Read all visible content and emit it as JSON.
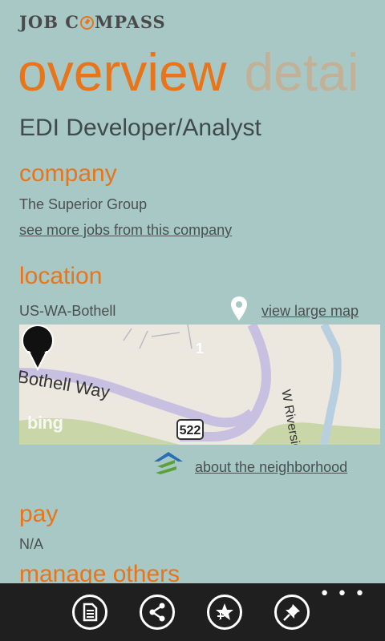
{
  "app": {
    "title_part1": "JOB C",
    "title_part2": "MPASS"
  },
  "pivot": {
    "active": "overview",
    "next": "detai"
  },
  "job": {
    "title": "EDI Developer/Analyst"
  },
  "company": {
    "heading": "company",
    "name": "The Superior Group",
    "more_jobs_link": "see more jobs from this company"
  },
  "location": {
    "heading": "location",
    "value": "US-WA-Bothell",
    "map_link": "view large map",
    "pin_icon": "map-pin-icon",
    "map": {
      "road_left": "Bothell Way",
      "road_right": "W Riverside D",
      "highway": "522",
      "pushpin_number": "1",
      "provider": "bing"
    },
    "neighborhood_link": "about the neighborhood",
    "neighborhood_icon": "zillow-icon"
  },
  "pay": {
    "heading": "pay",
    "value": "N/A"
  },
  "manage": {
    "heading": "manage others"
  },
  "appbar": {
    "ellipsis": "• • •",
    "buttons": [
      "notes-icon",
      "share-icon",
      "add-favorite-icon",
      "pin-to-start-icon"
    ]
  },
  "colors": {
    "accent": "#e8751a",
    "background": "#a8c8c6",
    "appbar": "#1f1f1f"
  }
}
